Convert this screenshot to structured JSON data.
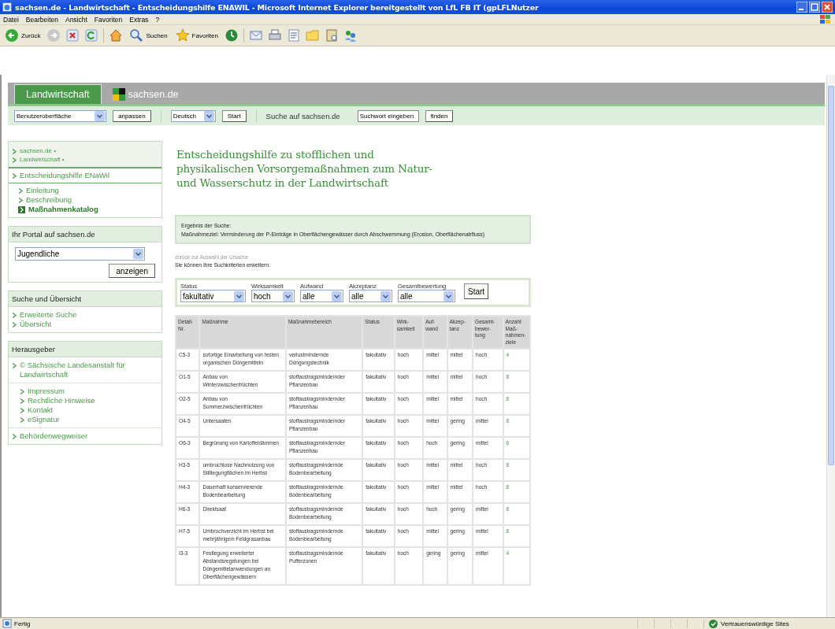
{
  "window": {
    "title": "sachsen.de - Landwirtschaft - Entscheidungshilfe ENAWIL - Microsoft Internet Explorer bereitgestellt von LfL FB IT (gpLFLNutzer"
  },
  "menu_bar": [
    "Datei",
    "Bearbeiten",
    "Ansicht",
    "Favoriten",
    "Extras",
    "?"
  ],
  "toolbar": [
    {
      "kind": "back",
      "label": "Zurück"
    },
    {
      "kind": "forward"
    },
    {
      "kind": "stop"
    },
    {
      "kind": "refresh"
    },
    {
      "kind": "home"
    },
    {
      "kind": "search",
      "label": "Suchen"
    },
    {
      "kind": "favorites",
      "label": "Favoriten"
    },
    {
      "kind": "history"
    },
    {
      "kind": "mail"
    },
    {
      "kind": "print"
    },
    {
      "kind": "edit"
    },
    {
      "kind": "folder"
    },
    {
      "kind": "research"
    },
    {
      "kind": "messenger"
    }
  ],
  "site_tabs": [
    {
      "label": "Landwirtschaft",
      "selected": true
    },
    {
      "label": "sachsen.de",
      "selected": false
    }
  ],
  "site_toolbar": {
    "ui_select": "Benutzeroberfläche",
    "customize_button": "anpassen",
    "language_select": "Deutsch",
    "start_button": "Start",
    "search_label": "Suche auf sachsen.de",
    "search_value": "Suchwort eingeben",
    "find_button": "finden"
  },
  "sidebar": {
    "breadcrumbs": [
      "sachsen.de •",
      "Landwirtschaft •"
    ],
    "section": {
      "label": "Entscheidungshilfe ENaWil",
      "children": [
        {
          "label": "Einleitung",
          "selected": false
        },
        {
          "label": "Beschreibung",
          "selected": false
        },
        {
          "label": "Maßnahmenkatalog",
          "selected": true
        }
      ]
    },
    "portal": {
      "title": "Ihr Portal auf sachsen.de",
      "select": "Jugendliche",
      "button": "anzeigen"
    },
    "search_box": {
      "title": "Suche und Übersicht",
      "items": [
        "Erweiterte Suche",
        "Übersicht"
      ]
    },
    "publisher": {
      "title": "Herausgeber",
      "name": "© Sächsische Landesanstalt für Landwirtschaft",
      "items": [
        "Impressum",
        "Rechtliche Hinweise",
        "Kontakt",
        "eSignatur"
      ],
      "extra": "Behördenwegweiser"
    }
  },
  "main": {
    "heading": "Entscheidungshilfe zu stofflichen und\nphysikalischen Vorsorgemaßnahmen zum Natur-\nund Wasserschutz in der Landwirtschaft",
    "result": {
      "title": "Ergebnis der Suche:",
      "text": "Maßnahmeziel: Verminderung der P-Einträge in Oberflächengewässer durch Abschwemmung (Erosion, Oberflächenabfluss)"
    },
    "back_link": "zurück zur Auswahl der Ursache",
    "hint": "Sie können Ihre Suchkriterien erweitern:",
    "filters": [
      {
        "label": "Status",
        "value": "fakultativ"
      },
      {
        "label": "Wirksamkeit",
        "value": "hoch"
      },
      {
        "label": "Aufwand",
        "value": "alle"
      },
      {
        "label": "Akzeptanz",
        "value": "alle"
      },
      {
        "label": "Gesamtbewertung",
        "value": "alle"
      }
    ],
    "filter_button": "Start",
    "table": {
      "columns": [
        "Detail-\nNr.",
        "Maßnahme",
        "Maßnahmebereich",
        "Status",
        "Wirk-\nsamkeit",
        "Auf-\nwand",
        "Akzep-\ntanz",
        "Gesamt-\nbewer-\ntung",
        "Anzahl\nMaß-\nnahmen-\nziele"
      ],
      "rows": [
        [
          "C5-3",
          "sofortige Einarbeitung von festen organischen Düngemitteln",
          "verlustmindernde Düngungstechnik",
          "fakultativ",
          "hoch",
          "mittel",
          "mittel",
          "hoch",
          "4"
        ],
        [
          "O1-5",
          "Anbau von Winterzwischenfrüchten",
          "stoffaustragsmindernder Pflanzenbau",
          "fakultativ",
          "hoch",
          "mittel",
          "mittel",
          "hoch",
          "8"
        ],
        [
          "O2-5",
          "Anbau von Sommerzwischenfrüchten",
          "stoffaustragsmindernder Pflanzenbau",
          "fakultativ",
          "hoch",
          "mittel",
          "mittel",
          "hoch",
          "8"
        ],
        [
          "O4-5",
          "Untersaaten",
          "stoffaustragsmindernder Pflanzenbau",
          "fakultativ",
          "hoch",
          "mittel",
          "gering",
          "mittel",
          "8"
        ],
        [
          "O6-3",
          "Begrünung von Kartoffeldämmen",
          "stoffaustragsmindernder Pflanzenbau",
          "fakultativ",
          "hoch",
          "hoch",
          "gering",
          "mittel",
          "6"
        ],
        [
          "H3-5",
          "umbruchlose Nachnutzung von Stilllegungflächen im Herbst",
          "stoffaustragsmindernde Bodenbearbeitung",
          "fakultativ",
          "hoch",
          "mittel",
          "mittel",
          "hoch",
          "8"
        ],
        [
          "H4-3",
          "Dauerhaft konservierende Bodenbearbeitung",
          "stoffaustragsmindernde Bodenbearbeitung",
          "fakultativ",
          "hoch",
          "mittel",
          "mittel",
          "hoch",
          "8"
        ],
        [
          "H6-3",
          "Direktsaat",
          "stoffaustragsmindernde Bodenbearbeitung",
          "fakultativ",
          "hoch",
          "hoch",
          "gering",
          "mittel",
          "8"
        ],
        [
          "H7-5",
          "Umbruchverzicht im Herbst bei mehrjährigem Feldgrasanbau",
          "stoffaustragsmindernde Bodenbearbeitung",
          "fakultativ",
          "hoch",
          "mittel",
          "gering",
          "mittel",
          "8"
        ],
        [
          "I3-3",
          "Festlegung erweiterter Abstandsregelungen bei Düngemittelanwendungen an Oberflächengewässern",
          "stoffaustragsmindernde Pufferzonen",
          "fakultativ",
          "hoch",
          "gering",
          "gering",
          "mittel",
          "4"
        ]
      ]
    }
  },
  "status_bar": {
    "text": "Fertig",
    "zone": "Vertrauenswürdige Sites"
  }
}
